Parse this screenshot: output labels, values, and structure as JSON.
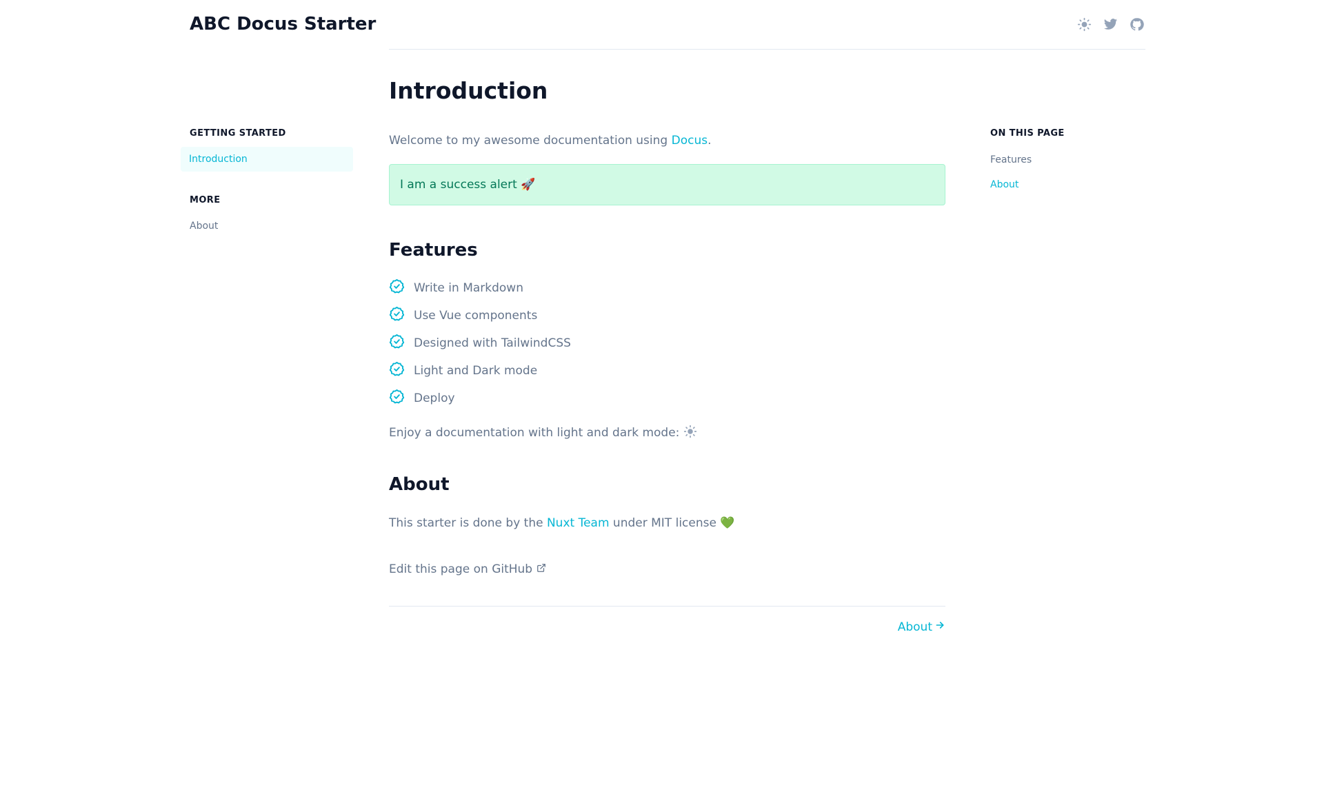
{
  "header": {
    "site_title": "ABC Docus Starter"
  },
  "sidebar": {
    "sections": [
      {
        "heading": "GETTING STARTED",
        "items": [
          {
            "label": "Introduction",
            "active": true
          }
        ]
      },
      {
        "heading": "MORE",
        "items": [
          {
            "label": "About",
            "active": false
          }
        ]
      }
    ]
  },
  "main": {
    "title": "Introduction",
    "intro_text": "Welcome to my awesome documentation using ",
    "intro_link": "Docus",
    "intro_end": ".",
    "alert": "I am a success alert 🚀",
    "features_heading": "Features",
    "features": [
      "Write in Markdown",
      "Use Vue components",
      "Designed with TailwindCSS",
      "Light and Dark mode",
      "Deploy"
    ],
    "mode_text": "Enjoy a documentation with light and dark mode:",
    "about_heading": "About",
    "about_text_before": "This starter is done by the ",
    "about_link": "Nuxt Team",
    "about_text_after": " under MIT license 💚",
    "edit_link": "Edit this page on GitHub",
    "next_link": "About"
  },
  "toc": {
    "heading": "ON THIS PAGE",
    "items": [
      {
        "label": "Features",
        "active": false
      },
      {
        "label": "About",
        "active": true
      }
    ]
  },
  "icons": {
    "theme": "sun-icon",
    "twitter": "twitter-icon",
    "github": "github-icon",
    "feature": "check-badge-icon",
    "edit": "external-link-icon",
    "next": "arrow-right-icon"
  },
  "colors": {
    "accent": "#06b6d4",
    "heading": "#0f172a",
    "body_text": "#64748b",
    "alert_bg": "#d1fae5",
    "alert_text": "#047857",
    "icon_gray": "#94a3b8"
  }
}
